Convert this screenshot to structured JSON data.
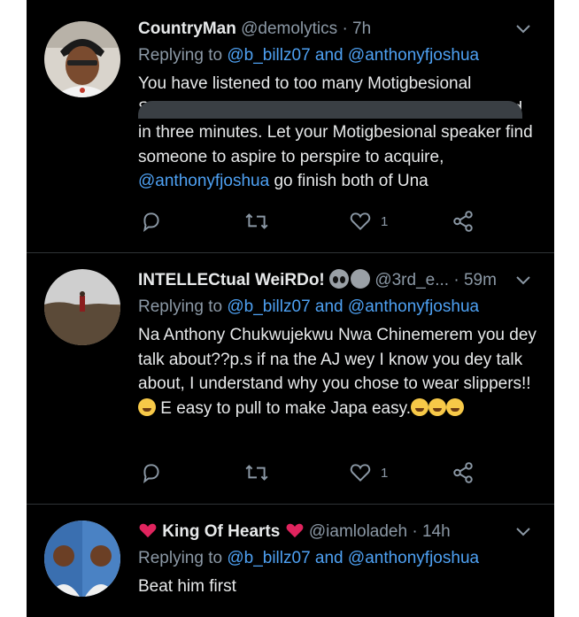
{
  "tweets": [
    {
      "name": "CountryMan",
      "handle": "@demolytics",
      "dot": "·",
      "time": "7h",
      "reply_prefix": "Replying to",
      "reply_user1": "@b_billz07",
      "reply_and": "and",
      "reply_user2": "@anthonyfjoshua",
      "body_text": "You have listened to too many Motigbesional Speakers. May God nor allow your life to be wasted in three minutes. Let your Motigbesional speaker find someone to aspire to perspire to acquire,",
      "body_mention": "@anthonyfjoshua",
      "body_tail": " go finish both of Una",
      "reply_count": "",
      "retweet_count": "",
      "like_count": "1"
    },
    {
      "name": "INTELLECtual WeiRDo!",
      "handle": "@3rd_e...",
      "dot": "·",
      "time": "59m",
      "reply_prefix": "Replying to",
      "reply_user1": "@b_billz07",
      "reply_and": "and",
      "reply_user2": "@anthonyfjoshua",
      "body_text": "Na Anthony Chukwujekwu Nwa Chinemerem you dey talk about??p.s if na the AJ wey I know you dey talk about, I understand why you chose to wear slippers!!",
      "body_mid": " E easy to pull to make Japa easy.",
      "reply_count": "",
      "retweet_count": "",
      "like_count": "1"
    },
    {
      "name": "King Of Hearts",
      "handle": "@iamloladeh",
      "dot": "·",
      "time": "14h",
      "reply_prefix": "Replying to",
      "reply_user1": "@b_billz07",
      "reply_and": "and",
      "reply_user2": "@anthonyfjoshua",
      "body_text": "Beat him first"
    }
  ],
  "icons": {
    "reply": "reply-icon",
    "retweet": "retweet-icon",
    "like": "heart-icon",
    "share": "share-icon",
    "more": "chevron-down-icon"
  },
  "colors": {
    "background": "#000000",
    "text": "#e7e9ea",
    "secondary": "#8b98a5",
    "mention": "#4ea1f3",
    "divider": "#2f3336"
  }
}
